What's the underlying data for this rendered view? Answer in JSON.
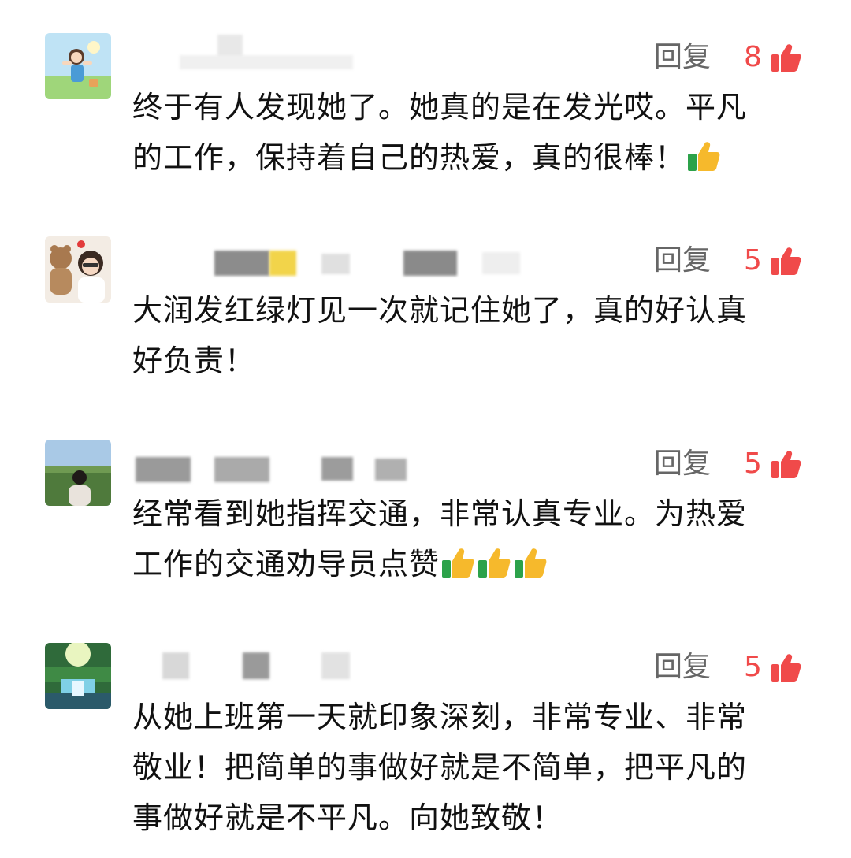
{
  "comments": [
    {
      "reply_label": "回复",
      "likes": "8",
      "text": "终于有人发现她了。她真的是在发光哎。平凡\n的工作，保持着自己的热爱，真的很棒！",
      "thumbs_emoji_count": 1
    },
    {
      "reply_label": "回复",
      "likes": "5",
      "text": "大润发红绿灯见一次就记住她了，真的好认真\n好负责！",
      "thumbs_emoji_count": 0
    },
    {
      "reply_label": "回复",
      "likes": "5",
      "text": "经常看到她指挥交通，非常认真专业。为热爱\n工作的交通劝导员点赞",
      "thumbs_emoji_count": 3
    },
    {
      "reply_label": "回复",
      "likes": "5",
      "text": "从她上班第一天就印象深刻，非常专业、非常\n敬业！把简单的事做好就是不简单，把平凡的\n事做好就是不平凡。向她致敬！",
      "thumbs_emoji_count": 0
    }
  ],
  "colors": {
    "like_red": "#f04a4a",
    "reply_gray": "#666666"
  },
  "icons": {
    "like": "thumbs-up-icon",
    "emoji": "thumbs-up-emoji-icon"
  }
}
